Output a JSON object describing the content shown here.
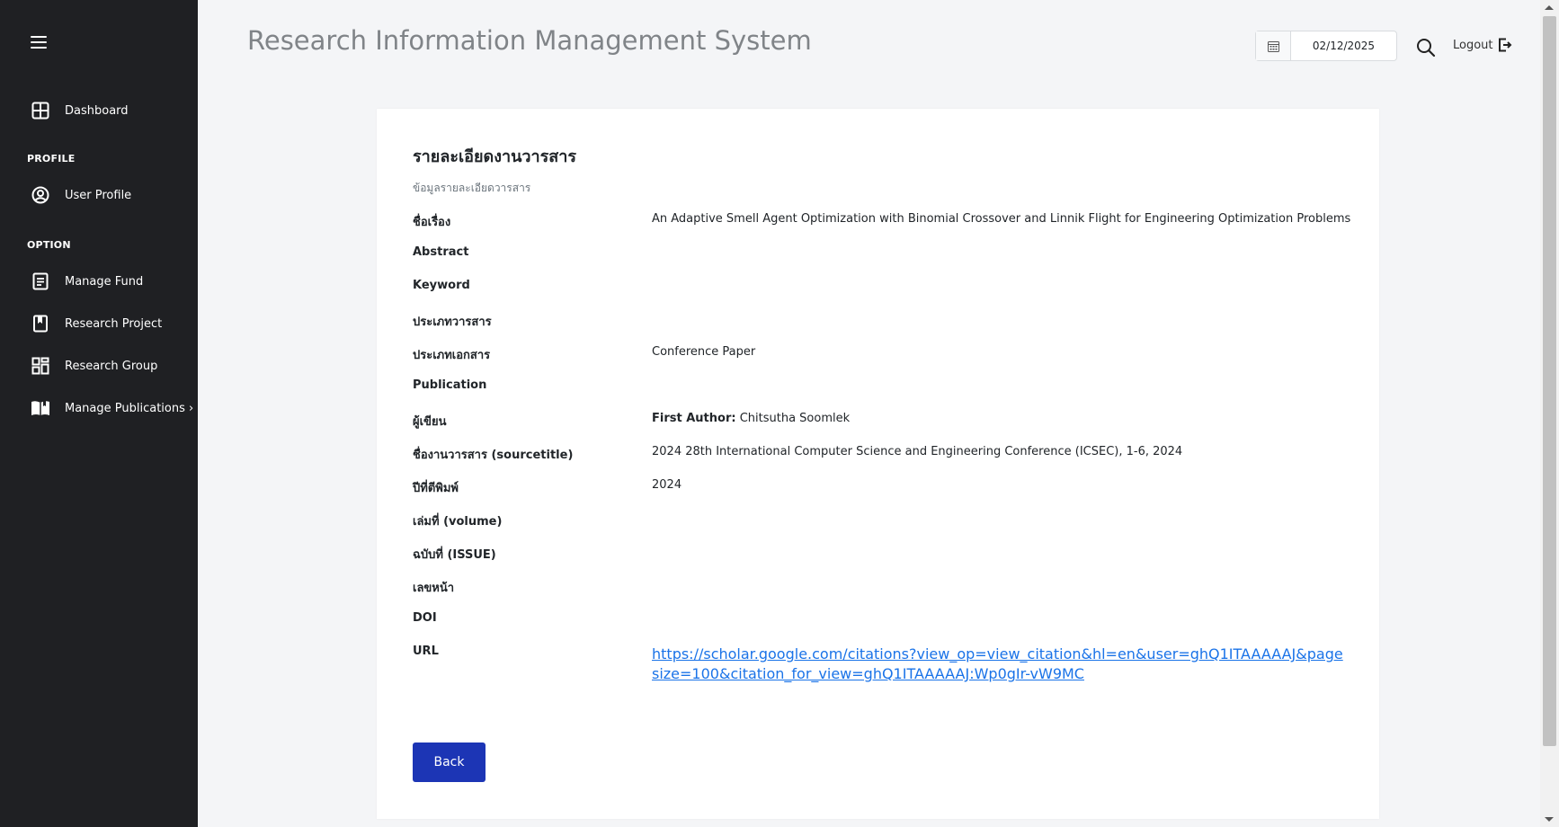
{
  "sidebar": {
    "items": [
      {
        "label": "Dashboard",
        "icon": "dashboard-icon"
      },
      {
        "label": "User Profile",
        "icon": "user-circle-icon"
      },
      {
        "label": "Manage Fund",
        "icon": "document-list-icon"
      },
      {
        "label": "Research Project",
        "icon": "bookmark-icon"
      },
      {
        "label": "Research Group",
        "icon": "grid-group-icon"
      },
      {
        "label": "Manage Publications ›",
        "icon": "open-book-icon"
      }
    ],
    "sections": {
      "profile": "PROFILE",
      "option": "OPTION"
    }
  },
  "header": {
    "title": "Research Information Management System",
    "date": "02/12/2025",
    "logout_label": "Logout"
  },
  "card": {
    "title": "รายละเอียดงานวารสาร",
    "subtitle": "ข้อมูลรายละเอียดวารสาร",
    "fields": {
      "title": {
        "label": "ชื่อเรื่อง",
        "value": "An Adaptive Smell Agent Optimization with Binomial Crossover and Linnik Flight for Engineering Optimization Problems"
      },
      "abstract": {
        "label": "Abstract",
        "value": ""
      },
      "keyword": {
        "label": "Keyword",
        "value": ""
      },
      "journal_type": {
        "label": "ประเภทวารสาร",
        "value": ""
      },
      "document_type": {
        "label": "ประเภทเอกสาร",
        "value": "Conference Paper"
      },
      "publication": {
        "label": "Publication",
        "value": ""
      },
      "author": {
        "label": "ผู้เขียน",
        "prefix": "First Author:",
        "value": " Chitsutha Soomlek"
      },
      "sourcetitle": {
        "label": "ชื่องานวารสาร (sourcetitle)",
        "value": "2024 28th International Computer Science and Engineering Conference (ICSEC), 1-6, 2024"
      },
      "year": {
        "label": "ปีที่ตีพิมพ์",
        "value": "2024"
      },
      "volume": {
        "label": "เล่มที่ (volume)",
        "value": ""
      },
      "issue": {
        "label": "ฉบับที่ (ISSUE)",
        "value": ""
      },
      "pages": {
        "label": "เลขหน้า",
        "value": ""
      },
      "doi": {
        "label": "DOI",
        "value": ""
      },
      "url": {
        "label": "URL",
        "value": "https://scholar.google.com/citations?view_op=view_citation&hl=en&user=ghQ1ITAAAAAJ&pagesize=100&citation_for_view=ghQ1ITAAAAAJ:Wp0gIr-vW9MC"
      }
    },
    "back_label": "Back"
  },
  "colors": {
    "sidebar_bg": "#1f2023",
    "page_bg": "#f4f5f7",
    "primary_button": "#1c35b5",
    "link": "#1a73e8"
  }
}
